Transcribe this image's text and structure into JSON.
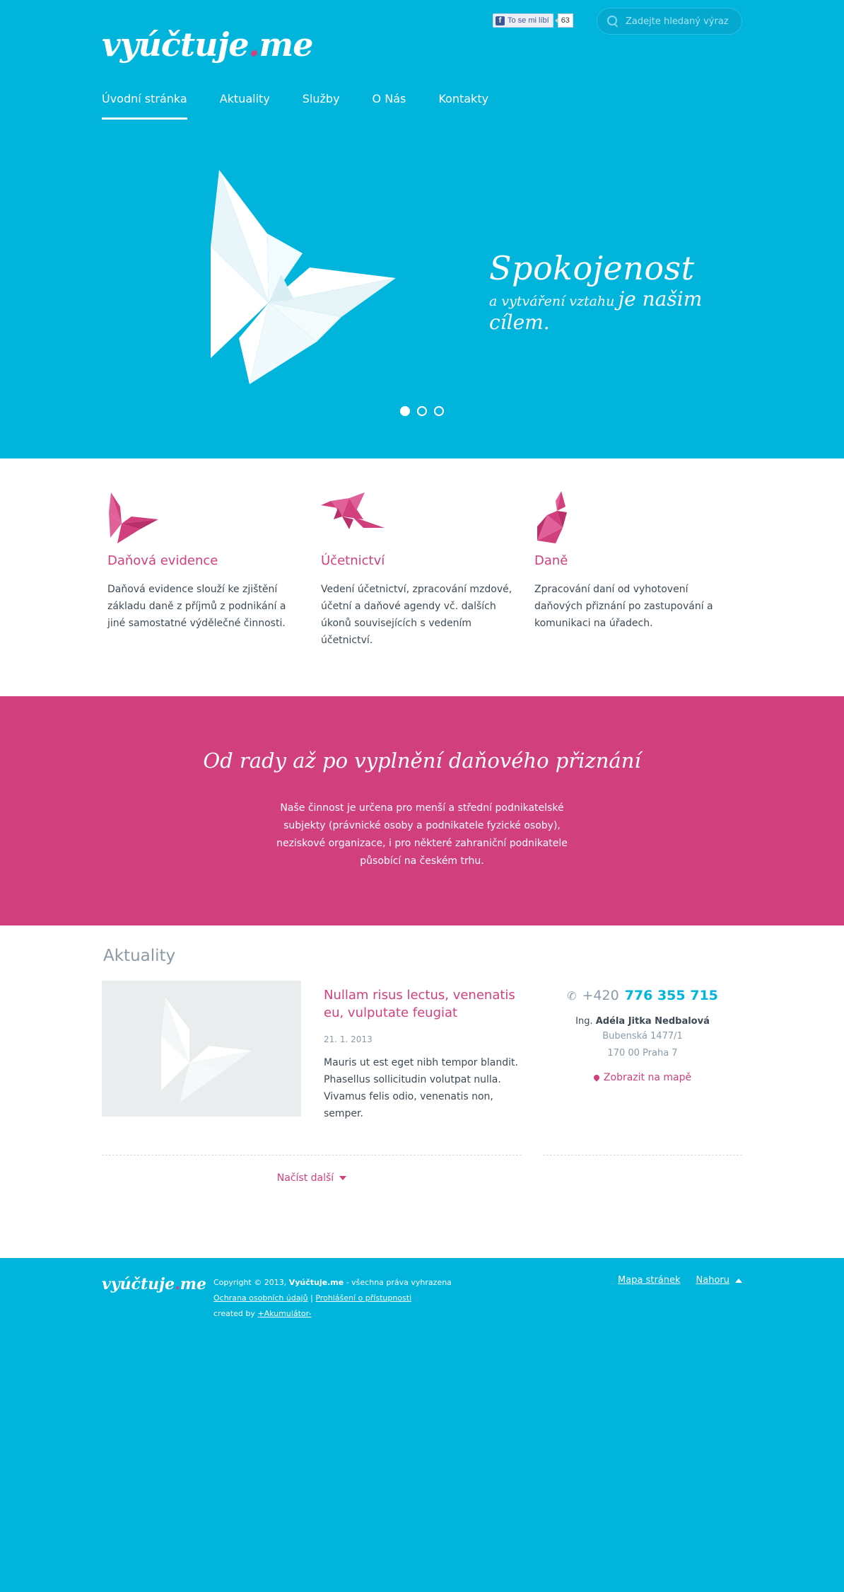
{
  "header": {
    "logo_main": "vyúčtuje",
    "logo_dot": ".",
    "logo_tld": "me",
    "fb_label": "To se mi líbí",
    "fb_count": "63",
    "search_placeholder": "Zadejte hledaný výraz"
  },
  "nav": {
    "items": [
      {
        "label": "Úvodní stránka",
        "active": true
      },
      {
        "label": "Aktuality",
        "active": false
      },
      {
        "label": "Služby",
        "active": false
      },
      {
        "label": "O Nás",
        "active": false
      },
      {
        "label": "Kontakty",
        "active": false
      }
    ]
  },
  "hero": {
    "slogan_big": "Spokojenost",
    "slogan_small": "a vytváření vztahu",
    "slogan_medium": "je našim cílem.",
    "slides_total": 3,
    "active_slide": 1
  },
  "services": [
    {
      "icon": "butterfly-icon",
      "title": "Daňová evidence",
      "text": "Daňová evidence slouží ke zjištění základu daně z příjmů z podnikání a jiné samostatné výdělečné činnosti."
    },
    {
      "icon": "bird-icon",
      "title": "Účetnictví",
      "text": "Vedení účetnictví, zpracování mzdové, účetní a daňové agendy vč. dalších úkonů souvisejících s vedením účetnictví."
    },
    {
      "icon": "rabbit-icon",
      "title": "Daně",
      "text": "Zpracování daní od vyhotovení daňových přiznání po zastupování a komunikaci na úřadech."
    }
  ],
  "band": {
    "title": "Od rady až po vyplnění daňového přiznání",
    "text": "Naše činnost je určena pro menší a střední podnikatelské subjekty (právnické osoby a podnikatele fyzické osoby), neziskové organizace, i pro některé zahraniční podnikatele působící na českém trhu."
  },
  "news": {
    "heading": "Aktuality",
    "article": {
      "title": "Nullam risus lectus, venenatis eu, vulputate feugiat",
      "date": "21. 1. 2013",
      "text": "Mauris ut est eget nibh tempor blandit. Phasellus sollicitudin volutpat nulla. Vivamus felis odio, venenatis non, semper."
    },
    "load_more": "Načíst další"
  },
  "contact": {
    "phone_prefix": "+420",
    "phone_number": "776 355 715",
    "name_prefix": "Ing.",
    "name": "Adéla Jitka Nedbalová",
    "street": "Bubenská 1477/1",
    "city": "170 00 Praha 7",
    "map_link": "Zobrazit na mapě"
  },
  "footer": {
    "logo_main": "vyúčtuje",
    "logo_dot": ".",
    "logo_tld": "me",
    "copyright_prefix": "Copyright © 2013,",
    "copyright_brand": "Vyúčtuje.me",
    "copyright_suffix": "- všechna práva vyhrazena",
    "privacy": "Ochrana osobních údajů",
    "separator": "|",
    "accessibility": "Prohlášení o přístupnosti",
    "created_prefix": "created by",
    "created_by": "+Akumulátor-",
    "sitemap": "Mapa stránek",
    "top": "Nahoru"
  },
  "colors": {
    "brand_blue": "#00b4dc",
    "brand_pink": "#d13f7d"
  }
}
